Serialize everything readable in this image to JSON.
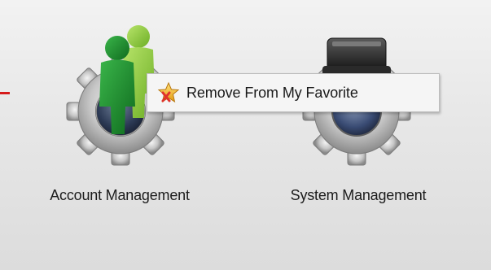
{
  "tiles": [
    {
      "label": "Account Management",
      "icon": "account-management-gear-icon"
    },
    {
      "label": "System Management",
      "icon": "system-management-gear-icon"
    }
  ],
  "context_menu": {
    "items": [
      {
        "label": "Remove From My Favorite",
        "icon": "star-remove-icon"
      }
    ]
  },
  "colors": {
    "accent_line": "#d61b1b",
    "person_front": "#1b8a2a",
    "person_back": "#8bcf3a",
    "star": "#f2b51e",
    "remove_x": "#e0322b"
  }
}
